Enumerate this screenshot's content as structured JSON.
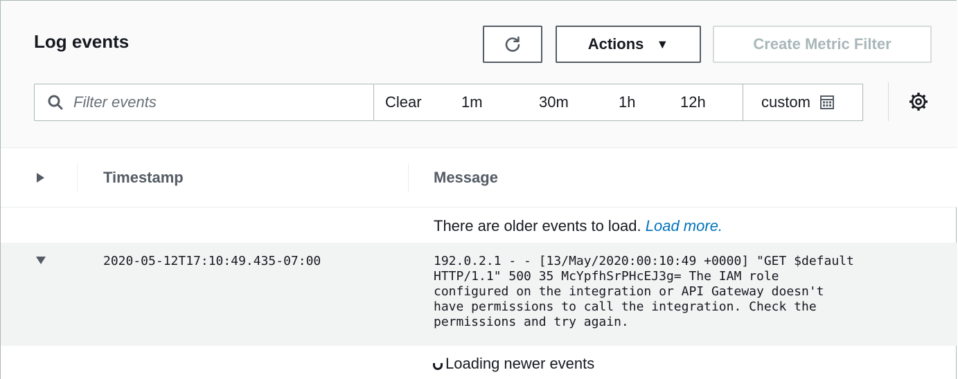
{
  "panel": {
    "title": "Log events",
    "refresh_icon": "refresh-icon",
    "actions_label": "Actions",
    "create_metric_filter_label": "Create Metric Filter"
  },
  "filter": {
    "placeholder": "Filter events",
    "value": ""
  },
  "time_range": {
    "clear_label": "Clear",
    "options": [
      "1m",
      "30m",
      "1h",
      "12h"
    ],
    "custom_label": "custom"
  },
  "table": {
    "columns": [
      "Timestamp",
      "Message"
    ]
  },
  "older_events": {
    "text": "There are older events to load.",
    "link": "Load more."
  },
  "events": [
    {
      "timestamp": "2020-05-12T17:10:49.435-07:00",
      "message": "192.0.2.1 - - [13/May/2020:00:10:49 +0000] \"GET $default\nHTTP/1.1\" 500 35 McYpfhSrPHcEJ3g= The IAM role\nconfigured on the integration or API Gateway doesn't\nhave permissions to call the integration. Check the\npermissions and try again."
    }
  ],
  "loading_text": "Loading newer events",
  "colors": {
    "link": "#0073bb",
    "border": "#aab7b8",
    "disabled_text": "#aab7b8",
    "row_highlight": "#f2f3f3"
  }
}
